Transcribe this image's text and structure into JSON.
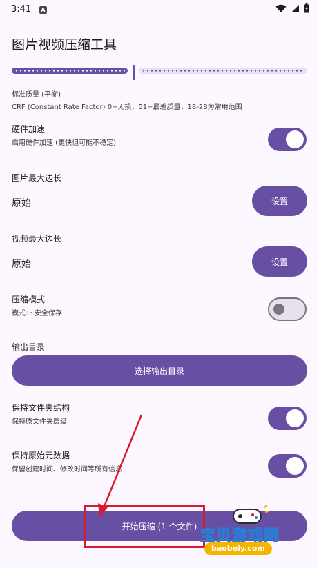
{
  "status_bar": {
    "time": "3:41",
    "badge": "A"
  },
  "page": {
    "title": "图片视频压缩工具"
  },
  "quality": {
    "label": "标准质量 (平衡)",
    "hint": "CRF (Constant Rate Factor) 0=无损，51=最差质量，18-28为常用范围",
    "slider_fraction": 0.4
  },
  "hardware_accel": {
    "title": "硬件加速",
    "subtitle": "启用硬件加速 (更快但可能不稳定)",
    "enabled": true
  },
  "image_max_edge": {
    "title": "图片最大边长",
    "value": "原始",
    "button": "设置"
  },
  "video_max_edge": {
    "title": "视频最大边长",
    "value": "原始",
    "button": "设置"
  },
  "compress_mode": {
    "title": "压缩模式",
    "subtitle": "模式1: 安全保存",
    "enabled": false
  },
  "output_dir": {
    "title": "输出目录",
    "button": "选择输出目录"
  },
  "keep_structure": {
    "title": "保持文件夹结构",
    "subtitle": "保持原文件夹层级",
    "enabled": true
  },
  "keep_metadata": {
    "title": "保持原始元数据",
    "subtitle": "保留创建时间、修改时间等所有信息",
    "enabled": true
  },
  "start_button": {
    "label": "开始压缩 (1 个文件)"
  },
  "watermark": {
    "text": "宝贝游戏网",
    "url": "baobeiy.com"
  },
  "colors": {
    "primary": "#6750a4",
    "annotation": "#d81b2c",
    "background": "#fdf7ff"
  }
}
